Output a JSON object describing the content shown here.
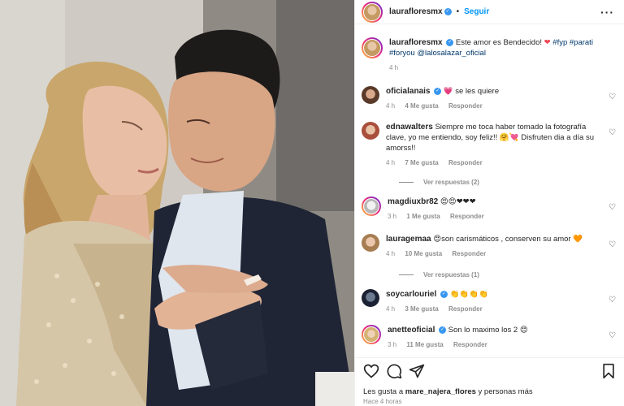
{
  "header": {
    "username": "laurafloresmx",
    "follow_label": "Seguir",
    "more_label": "···"
  },
  "caption": {
    "username": "laurafloresmx",
    "text": "Este amor es Bendecido!",
    "emoji": "❤",
    "hashtags": "#fyp #parati #foryou",
    "mention": "@lalosalazar_oficial",
    "time": "4 h"
  },
  "comments": [
    {
      "username": "oficialanais",
      "verified": true,
      "text": "se les quiere",
      "emoji_before": "💗",
      "time": "4 h",
      "likes": "4 Me gusta",
      "reply": "Responder"
    },
    {
      "username": "ednawalters",
      "verified": false,
      "text": "Siempre me toca haber tomado la fotografía clave, yo me entiendo, soy feliz!! 🤗💘 Disfruten dia a día su amorss!!",
      "time": "4 h",
      "likes": "7 Me gusta",
      "reply": "Responder",
      "view_replies": "Ver respuestas (2)"
    },
    {
      "username": "magdiuxbr82",
      "verified": false,
      "text": "😍😍❤❤❤",
      "time": "3 h",
      "likes": "1 Me gusta",
      "reply": "Responder"
    },
    {
      "username": "lauragemaa",
      "verified": false,
      "text": "😍son carismáticos , conserven su amor 🧡",
      "time": "4 h",
      "likes": "10 Me gusta",
      "reply": "Responder",
      "view_replies": "Ver respuestas (1)"
    },
    {
      "username": "soycarlouriel",
      "verified": true,
      "text": "👏👏👏👏",
      "time": "4 h",
      "likes": "3 Me gusta",
      "reply": "Responder"
    },
    {
      "username": "anetteoficial",
      "verified": true,
      "text": "Son lo maximo los 2 😍",
      "time": "3 h",
      "likes": "11 Me gusta",
      "reply": "Responder"
    }
  ],
  "footer": {
    "likes_prefix": "Les gusta a",
    "liker": "mare_najera_flores",
    "likes_suffix": "y personas más",
    "time": "Hace 4 horas"
  },
  "icons": {
    "like": "heart-icon",
    "comment": "comment-icon",
    "share": "share-icon",
    "save": "bookmark-icon"
  },
  "colors": {
    "accent": "#0095f6",
    "heart": "#ed4956",
    "verified": "#3897f0"
  }
}
